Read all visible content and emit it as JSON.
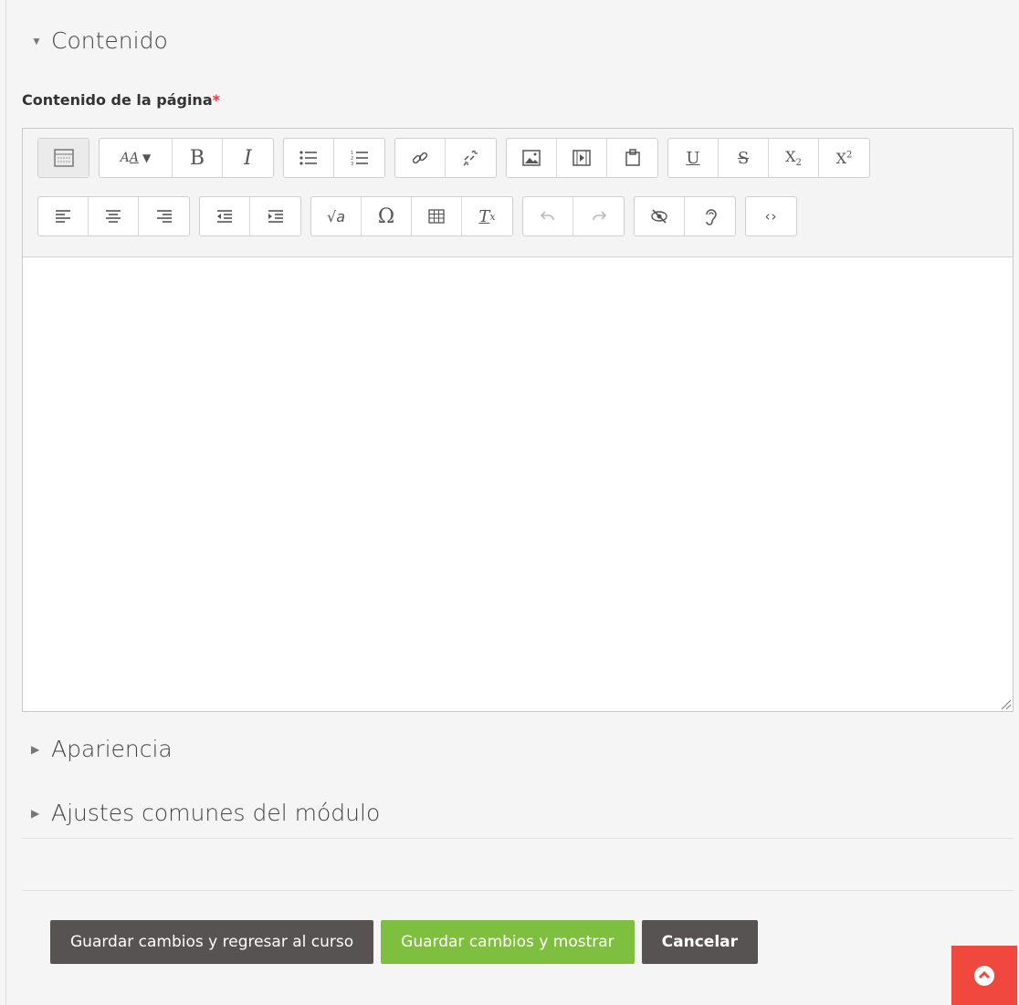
{
  "sections": {
    "contenido": "Contenido",
    "apariencia": "Apariencia",
    "ajustes": "Ajustes comunes del módulo"
  },
  "field": {
    "label": "Contenido de la página",
    "required_mark": "*"
  },
  "toolbar": {
    "row1_icons": [
      "toolbar-toggle-icon",
      "font-size-icon",
      "bold-icon",
      "italic-icon",
      "unordered-list-icon",
      "ordered-list-icon",
      "link-icon",
      "unlink-icon",
      "image-icon",
      "media-icon",
      "manage-files-icon",
      "underline-icon",
      "strikethrough-icon",
      "subscript-icon",
      "superscript-icon"
    ],
    "row2_icons": [
      "align-left-icon",
      "align-center-icon",
      "align-right-icon",
      "outdent-icon",
      "indent-icon",
      "equation-icon",
      "special-character-icon",
      "table-icon",
      "clear-formatting-icon",
      "undo-icon",
      "redo-icon",
      "accessibility-checker-icon",
      "screenreader-helper-icon",
      "html-icon"
    ]
  },
  "actions": {
    "save_return": "Guardar cambios y regresar al curso",
    "save_show": "Guardar cambios y mostrar",
    "cancel": "Cancelar"
  },
  "colors": {
    "dark_button": "#575353",
    "green_button": "#7ebf3f",
    "scroll_top": "#f0483e",
    "required": "#e53935"
  }
}
